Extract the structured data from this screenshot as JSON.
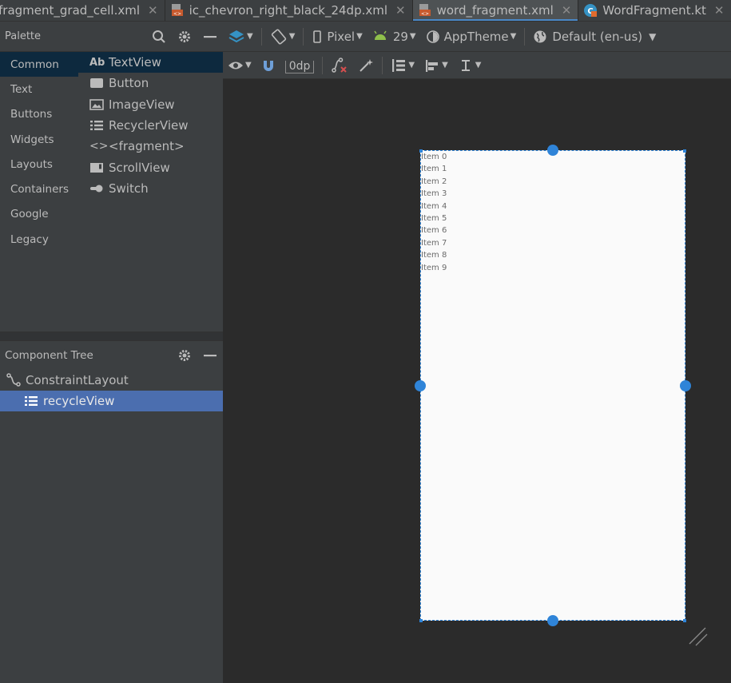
{
  "tabs": [
    {
      "label": "fragment_grad_cell.xml",
      "icon": "xml-file-icon",
      "active": false
    },
    {
      "label": "ic_chevron_right_black_24dp.xml",
      "icon": "xml-file-icon",
      "active": false
    },
    {
      "label": "word_fragment.xml",
      "icon": "xml-file-icon",
      "active": true
    },
    {
      "label": "WordFragment.kt",
      "icon": "kotlin-file-icon",
      "active": false
    },
    {
      "label": "",
      "icon": "kotlin-file-icon",
      "active": false
    }
  ],
  "palette": {
    "title": "Palette",
    "categories": [
      "Common",
      "Text",
      "Buttons",
      "Widgets",
      "Layouts",
      "Containers",
      "Google",
      "Legacy"
    ],
    "selected_category": "Common",
    "components": [
      {
        "label": "TextView",
        "icon": "textview-icon",
        "glyph": "Ab"
      },
      {
        "label": "Button",
        "icon": "button-icon",
        "glyph": ""
      },
      {
        "label": "ImageView",
        "icon": "imageview-icon",
        "glyph": ""
      },
      {
        "label": "RecyclerView",
        "icon": "recyclerview-icon",
        "glyph": ""
      },
      {
        "label": "<fragment>",
        "icon": "fragment-icon",
        "glyph": "<>"
      },
      {
        "label": "ScrollView",
        "icon": "scrollview-icon",
        "glyph": ""
      },
      {
        "label": "Switch",
        "icon": "switch-icon",
        "glyph": ""
      }
    ]
  },
  "component_tree": {
    "title": "Component Tree",
    "nodes": [
      {
        "label": "ConstraintLayout",
        "icon": "constraintlayout-icon",
        "selected": false
      },
      {
        "label": "recycleView",
        "icon": "recyclerview-icon",
        "selected": true
      }
    ]
  },
  "toolbar": {
    "device": "Pixel",
    "api": "29",
    "theme": "AppTheme",
    "locale": "Default (en-us)",
    "margin": "0dp"
  },
  "preview": {
    "items": [
      "Item 0",
      "Item 1",
      "Item 2",
      "Item 3",
      "Item 4",
      "Item 5",
      "Item 6",
      "Item 7",
      "Item 8",
      "Item 9"
    ]
  },
  "colors": {
    "accent": "#4a88c7",
    "selection": "#4b6eaf",
    "handle": "#2f84d8"
  }
}
